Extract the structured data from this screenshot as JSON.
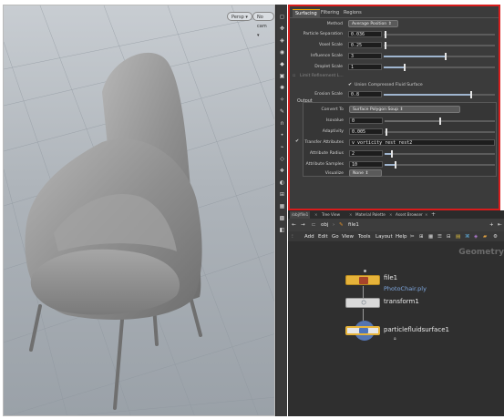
{
  "viewport": {
    "persp_label": "Persp ▾",
    "cam_label": "No cam ▾"
  },
  "params": {
    "tabs": [
      "Surfacing",
      "Filtering",
      "Regions"
    ],
    "method": {
      "label": "Method",
      "value": "Average Position"
    },
    "particle_separation": {
      "label": "Particle Separation",
      "value": "0.036",
      "level": 0.02
    },
    "voxel_scale": {
      "label": "Voxel Scale",
      "value": "0.25",
      "level": 0.02
    },
    "influence_scale": {
      "label": "Influence Scale",
      "value": "3",
      "level": 0.55
    },
    "droplet_scale": {
      "label": "Droplet Scale",
      "value": "1",
      "level": 0.18
    },
    "limit_refinement": {
      "label": "Limit Refinement L..."
    },
    "union_compressed": {
      "label": "Union Compressed Fluid Surface",
      "checked": true
    },
    "erosion_scale": {
      "label": "Erosion Scale",
      "value": "0.8",
      "level": 0.78
    },
    "output": {
      "label": "Output"
    },
    "convert_to": {
      "label": "Convert To",
      "value": "Surface Polygon Soup"
    },
    "isovalue": {
      "label": "Isovalue",
      "value": "0",
      "level": 0.5
    },
    "adaptivity": {
      "label": "Adaptivity",
      "value": "0.005",
      "level": 0.01
    },
    "transfer_attributes": {
      "label": "Transfer Attributes",
      "value": "v vorticity rest rest2",
      "checked": true
    },
    "attribute_radius": {
      "label": "Attribute Radius",
      "value": "2",
      "level": 0.06
    },
    "attribute_samples": {
      "label": "Attribute Samples",
      "value": "10",
      "level": 0.09
    },
    "visualize": {
      "label": "Visualize",
      "value": "None"
    }
  },
  "network": {
    "tabs": [
      "/obj/file1",
      "Tree View",
      "Material Palette",
      "Asset Browser",
      "+"
    ],
    "path_obj": "obj",
    "path_file": "file1",
    "menu": [
      "Add",
      "Edit",
      "Go",
      "View",
      "Tools",
      "Layout",
      "Help"
    ],
    "context_label": "Geometry",
    "nodes": {
      "file": {
        "name": "file1",
        "subtitle": "PhotoChair.ply"
      },
      "transform": {
        "name": "transform1"
      },
      "fluid": {
        "name": "particlefluidsurface1"
      }
    }
  },
  "colors": {
    "highlight_border": "#d81c1c",
    "file_node": "#e6b33a",
    "fluid_node": "#5a80c8",
    "subtitle_link": "#7fa8e0"
  }
}
